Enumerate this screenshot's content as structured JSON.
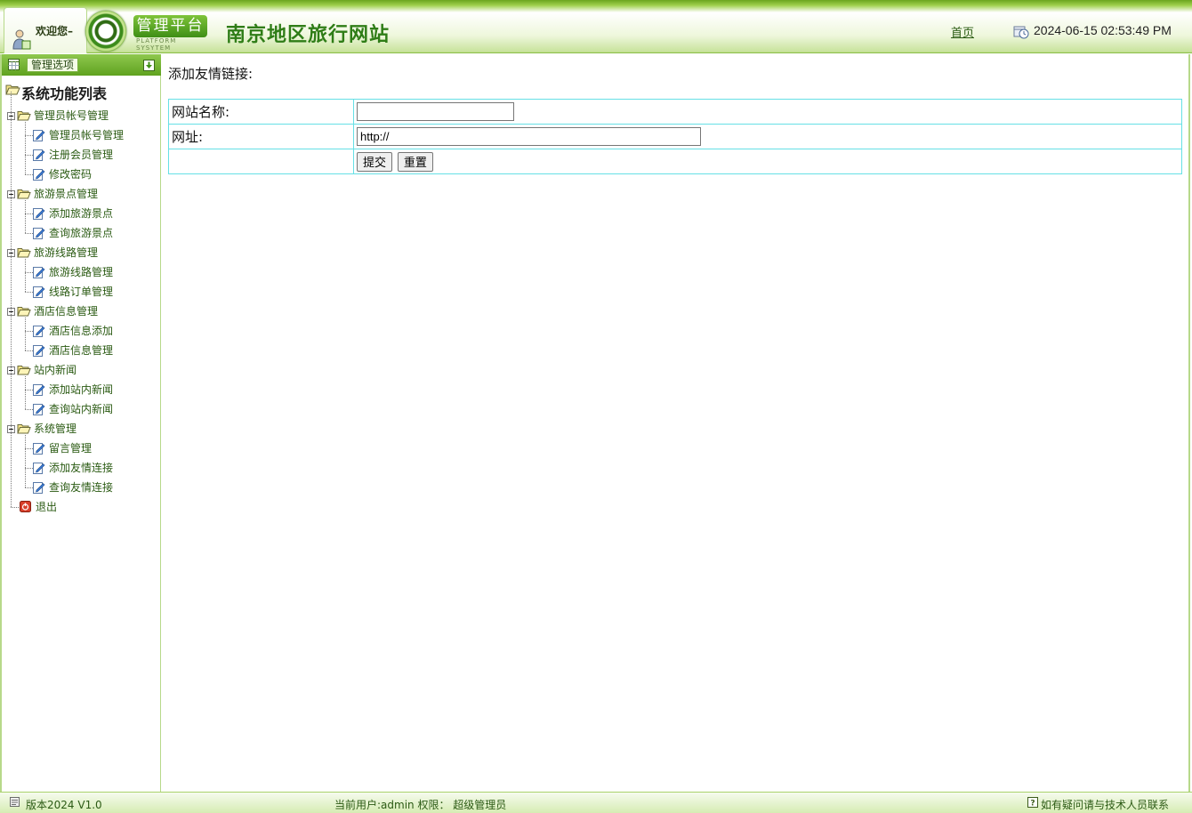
{
  "header": {
    "welcome": "欢迎您–",
    "logo_badge": "管理平台",
    "logo_sub": "PLATFORM SYSYTEM",
    "site_title": "南京地区旅行网站",
    "home_link": "首页",
    "datetime": "2024-06-15 02:53:49 PM"
  },
  "sidebar": {
    "header_label": "管理选项",
    "root_label": "系统功能列表",
    "groups": [
      {
        "label": "管理员帐号管理",
        "items": [
          "管理员帐号管理",
          "注册会员管理",
          "修改密码"
        ]
      },
      {
        "label": "旅游景点管理",
        "items": [
          "添加旅游景点",
          "查询旅游景点"
        ]
      },
      {
        "label": "旅游线路管理",
        "items": [
          "旅游线路管理",
          "线路订单管理"
        ]
      },
      {
        "label": "酒店信息管理",
        "items": [
          "酒店信息添加",
          "酒店信息管理"
        ]
      },
      {
        "label": "站内新闻",
        "items": [
          "添加站内新闻",
          "查询站内新闻"
        ]
      },
      {
        "label": "系统管理",
        "items": [
          "留言管理",
          "添加友情连接",
          "查询友情连接"
        ]
      }
    ],
    "logout": "退出"
  },
  "main": {
    "heading": "添加友情链接:",
    "form": {
      "name_label": "网站名称:",
      "name_value": "",
      "url_label": "网址:",
      "url_value": "http://",
      "submit_label": "提交",
      "reset_label": "重置"
    }
  },
  "footer": {
    "version": "版本2024 V1.0",
    "current_user": "当前用户:admin 权限： 超级管理员",
    "help": "如有疑问请与技术人员联系"
  },
  "colors": {
    "brand_green": "#5fa21f",
    "link_green": "#2a5a12",
    "table_border": "#66e0e6"
  }
}
